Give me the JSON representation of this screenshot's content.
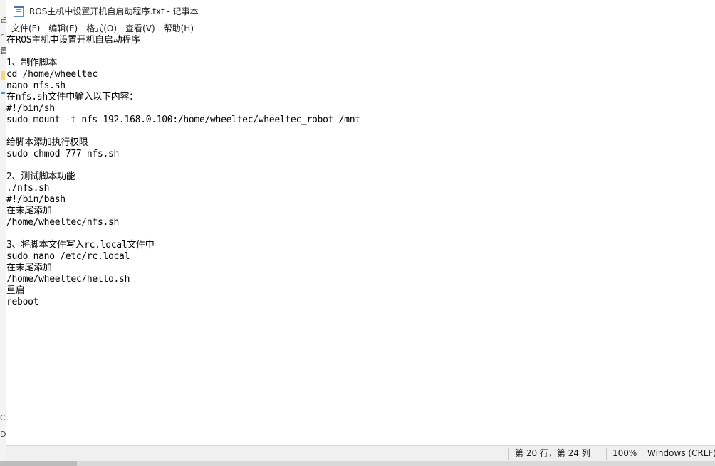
{
  "window": {
    "title": "ROS主机中设置开机自启动程序.txt - 记事本",
    "icon": "notepad-icon"
  },
  "menu": [
    {
      "label": "文件(F)"
    },
    {
      "label": "编辑(E)"
    },
    {
      "label": "格式(O)"
    },
    {
      "label": "查看(V)"
    },
    {
      "label": "帮助(H)"
    }
  ],
  "editor": {
    "lines": [
      "在ROS主机中设置开机自启动程序",
      "",
      "1、制作脚本",
      "cd /home/wheeltec",
      "nano nfs.sh",
      "在nfs.sh文件中输入以下内容：",
      "#!/bin/sh",
      "sudo mount -t nfs 192.168.0.100:/home/wheeltec/wheeltec_robot /mnt",
      "",
      "给脚本添加执行权限",
      "sudo chmod 777 nfs.sh",
      "",
      "2、测试脚本功能",
      "./nfs.sh",
      "#!/bin/bash",
      "在末尾添加",
      "/home/wheeltec/nfs.sh",
      "",
      "3、将脚本文件写入rc.local文件中",
      "sudo nano /etc/rc.local",
      "在末尾添加",
      "/home/wheeltec/hello.sh",
      "重启",
      "reboot"
    ]
  },
  "statusbar": {
    "position": "第 20 行，第 24 列",
    "zoom": "100%",
    "line_ending": "Windows (CRLF)"
  },
  "background_fragments": [
    "占",
    "r",
    "置",
    "C",
    "D:"
  ]
}
